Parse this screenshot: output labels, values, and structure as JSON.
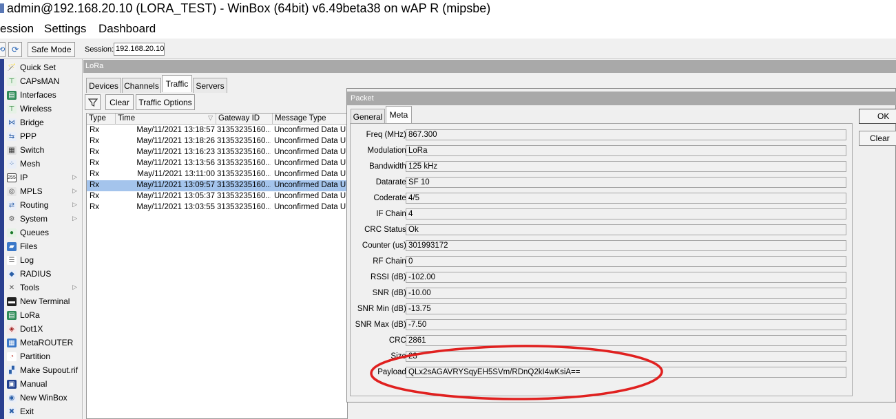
{
  "window": {
    "title": "admin@192.168.20.10 (LORA_TEST) - WinBox (64bit) v6.49beta38 on wAP R (mipsbe)"
  },
  "menu": {
    "items": [
      "ession",
      "Settings",
      "Dashboard"
    ]
  },
  "toolbar": {
    "safe_mode_label": "Safe Mode",
    "session_label": "Session:",
    "session_value": "192.168.20.10"
  },
  "sidebar": {
    "items": [
      {
        "label": "Quick Set",
        "icon": "wand-icon",
        "submenu": false
      },
      {
        "label": "CAPsMAN",
        "icon": "antenna-icon",
        "submenu": false
      },
      {
        "label": "Interfaces",
        "icon": "interfaces-icon",
        "submenu": false
      },
      {
        "label": "Wireless",
        "icon": "wireless-icon",
        "submenu": false
      },
      {
        "label": "Bridge",
        "icon": "bridge-icon",
        "submenu": false
      },
      {
        "label": "PPP",
        "icon": "ppp-icon",
        "submenu": false
      },
      {
        "label": "Switch",
        "icon": "switch-icon",
        "submenu": false
      },
      {
        "label": "Mesh",
        "icon": "mesh-icon",
        "submenu": false
      },
      {
        "label": "IP",
        "icon": "ip-icon",
        "submenu": true
      },
      {
        "label": "MPLS",
        "icon": "mpls-icon",
        "submenu": true
      },
      {
        "label": "Routing",
        "icon": "routing-icon",
        "submenu": true
      },
      {
        "label": "System",
        "icon": "gear-icon",
        "submenu": true
      },
      {
        "label": "Queues",
        "icon": "queues-icon",
        "submenu": false
      },
      {
        "label": "Files",
        "icon": "folder-icon",
        "submenu": false
      },
      {
        "label": "Log",
        "icon": "log-icon",
        "submenu": false
      },
      {
        "label": "RADIUS",
        "icon": "users-icon",
        "submenu": false
      },
      {
        "label": "Tools",
        "icon": "tools-icon",
        "submenu": true
      },
      {
        "label": "New Terminal",
        "icon": "terminal-icon",
        "submenu": false
      },
      {
        "label": "LoRa",
        "icon": "lora-icon",
        "submenu": false
      },
      {
        "label": "Dot1X",
        "icon": "dot1x-icon",
        "submenu": false
      },
      {
        "label": "MetaROUTER",
        "icon": "metarouter-icon",
        "submenu": false
      },
      {
        "label": "Partition",
        "icon": "partition-icon",
        "submenu": false
      },
      {
        "label": "Make Supout.rif",
        "icon": "supout-icon",
        "submenu": false
      },
      {
        "label": "Manual",
        "icon": "manual-icon",
        "submenu": false
      },
      {
        "label": "New WinBox",
        "icon": "winbox-icon",
        "submenu": false
      },
      {
        "label": "Exit",
        "icon": "exit-icon",
        "submenu": false
      }
    ]
  },
  "lora": {
    "title": "LoRa",
    "tabs": [
      "Devices",
      "Channels",
      "Traffic",
      "Servers"
    ],
    "active_tab": "Traffic",
    "buttons": {
      "clear": "Clear",
      "traffic_options": "Traffic Options"
    },
    "columns": [
      "Type",
      "Time",
      "Gateway ID",
      "Message Type"
    ],
    "rows": [
      {
        "type": "Rx",
        "time": "May/11/2021 13:18:57",
        "gateway": "31353235160...",
        "message": "Unconfirmed Data Up",
        "selected": false
      },
      {
        "type": "Rx",
        "time": "May/11/2021 13:18:26",
        "gateway": "31353235160...",
        "message": "Unconfirmed Data Up",
        "selected": false
      },
      {
        "type": "Rx",
        "time": "May/11/2021 13:16:23",
        "gateway": "31353235160...",
        "message": "Unconfirmed Data Up",
        "selected": false
      },
      {
        "type": "Rx",
        "time": "May/11/2021 13:13:56",
        "gateway": "31353235160...",
        "message": "Unconfirmed Data Up",
        "selected": false
      },
      {
        "type": "Rx",
        "time": "May/11/2021 13:11:00",
        "gateway": "31353235160...",
        "message": "Unconfirmed Data Up",
        "selected": false
      },
      {
        "type": "Rx",
        "time": "May/11/2021 13:09:57",
        "gateway": "31353235160...",
        "message": "Unconfirmed Data Up",
        "selected": true
      },
      {
        "type": "Rx",
        "time": "May/11/2021 13:05:37",
        "gateway": "31353235160...",
        "message": "Unconfirmed Data Up",
        "selected": false
      },
      {
        "type": "Rx",
        "time": "May/11/2021 13:03:55",
        "gateway": "31353235160...",
        "message": "Unconfirmed Data Up",
        "selected": false
      }
    ]
  },
  "packet": {
    "title": "Packet",
    "tabs": [
      "General",
      "Meta"
    ],
    "active_tab": "Meta",
    "buttons": {
      "ok": "OK",
      "clear": "Clear"
    },
    "fields": [
      {
        "label": "Freq (MHz):",
        "value": "867.300"
      },
      {
        "label": "Modulation:",
        "value": "LoRa"
      },
      {
        "label": "Bandwidth:",
        "value": "125 kHz"
      },
      {
        "label": "Datarate:",
        "value": "SF 10"
      },
      {
        "label": "Coderate:",
        "value": "4/5"
      },
      {
        "label": "IF Chain:",
        "value": "4"
      },
      {
        "label": "CRC Status:",
        "value": "Ok"
      },
      {
        "label": "Counter (us):",
        "value": "301993172"
      },
      {
        "label": "RF Chain:",
        "value": "0"
      },
      {
        "label": "RSSI (dB):",
        "value": "-102.00"
      },
      {
        "label": "SNR (dB):",
        "value": "-10.00"
      },
      {
        "label": "SNR Min (dB):",
        "value": "-13.75"
      },
      {
        "label": "SNR Max (dB):",
        "value": "-7.50"
      },
      {
        "label": "CRC:",
        "value": "2861"
      },
      {
        "label": "Size:",
        "value": "23"
      },
      {
        "label": "Payload:",
        "value": "QLx2sAGAVRYSqyEH5SVm/RDnQ2kI4wKsiA=="
      }
    ]
  },
  "annotation": {
    "color": "#e0201f",
    "shape": "hand-drawn ellipse"
  },
  "colors": {
    "sidebar_stripe": "#2a3f8f",
    "selected_row": "#a4c4ec",
    "title_bar_gray": "#a9a9a9"
  }
}
